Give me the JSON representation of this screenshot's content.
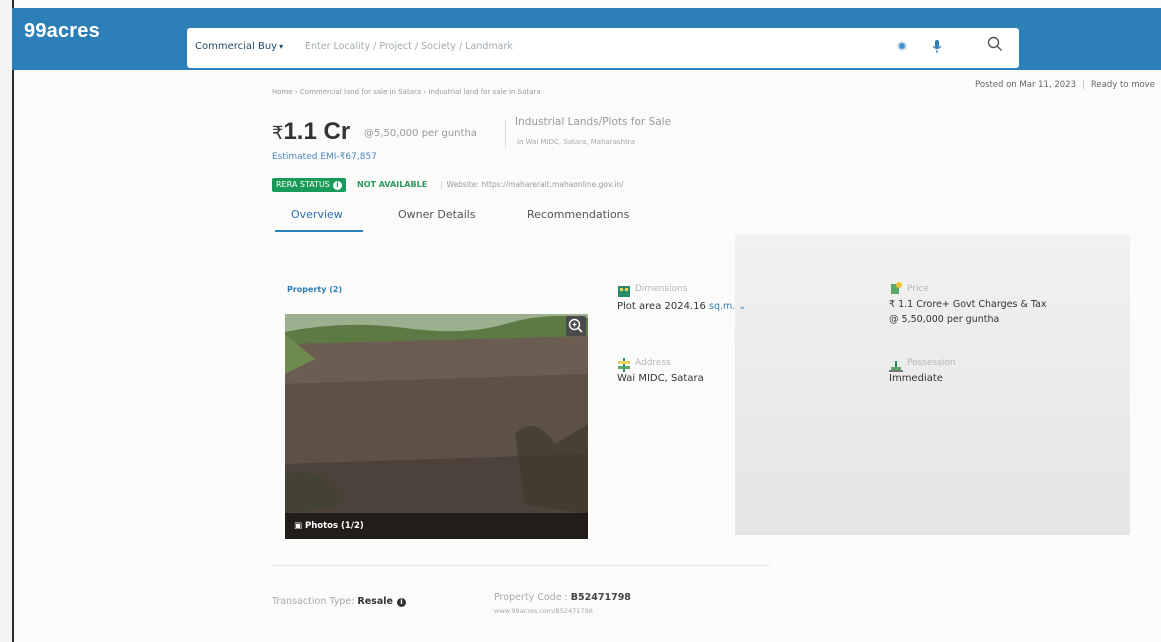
{
  "header": {
    "logo": "99acres",
    "search_type": "Commercial Buy",
    "search_placeholder": "Enter Locality / Project / Society / Landmark"
  },
  "breadcrumb": "Home › Commercial land for sale in Satara › Industrial land for sale in Satara",
  "posted": {
    "date": "Posted on Mar 11, 2023",
    "status": "Ready to move"
  },
  "listing": {
    "price": "1.1 Cr",
    "currency_symbol": "₹",
    "price_per_unit": "@5,50,000 per guntha",
    "emi": "Estimated EMI-₹67,857",
    "title": "Industrial Lands/Plots for Sale",
    "location": "in Wai MIDC, Satara, Maharashtra"
  },
  "rera": {
    "badge": "RERA STATUS",
    "status": "NOT AVAILABLE",
    "website": "Website: https://maharerait.mahaonline.gov.in/"
  },
  "tabs": [
    {
      "label": "Overview",
      "active": true
    },
    {
      "label": "Owner Details",
      "active": false
    },
    {
      "label": "Recommendations",
      "active": false
    }
  ],
  "property": {
    "label": "Property (2)",
    "photos_label": "Photos (1/2)"
  },
  "attributes": {
    "dimensions": {
      "label": "Dimensions",
      "value": "Plot area 2024.16",
      "unit": "sq.m."
    },
    "price": {
      "label": "Price",
      "value": "₹ 1.1 Crore+ Govt Charges & Tax",
      "sub": "@ 5,50,000 per guntha"
    },
    "address": {
      "label": "Address",
      "value": "Wai MIDC, Satara"
    },
    "possession": {
      "label": "Possession",
      "value": "Immediate"
    }
  },
  "footer": {
    "transaction_label": "Transaction Type:",
    "transaction_value": "Resale",
    "code_label": "Property Code :",
    "code_value": "B52471798",
    "code_url": "www.99acres.com/B52471798"
  },
  "colors": {
    "brand": "#2d7fb8",
    "rera_green": "#1a9a5a"
  }
}
